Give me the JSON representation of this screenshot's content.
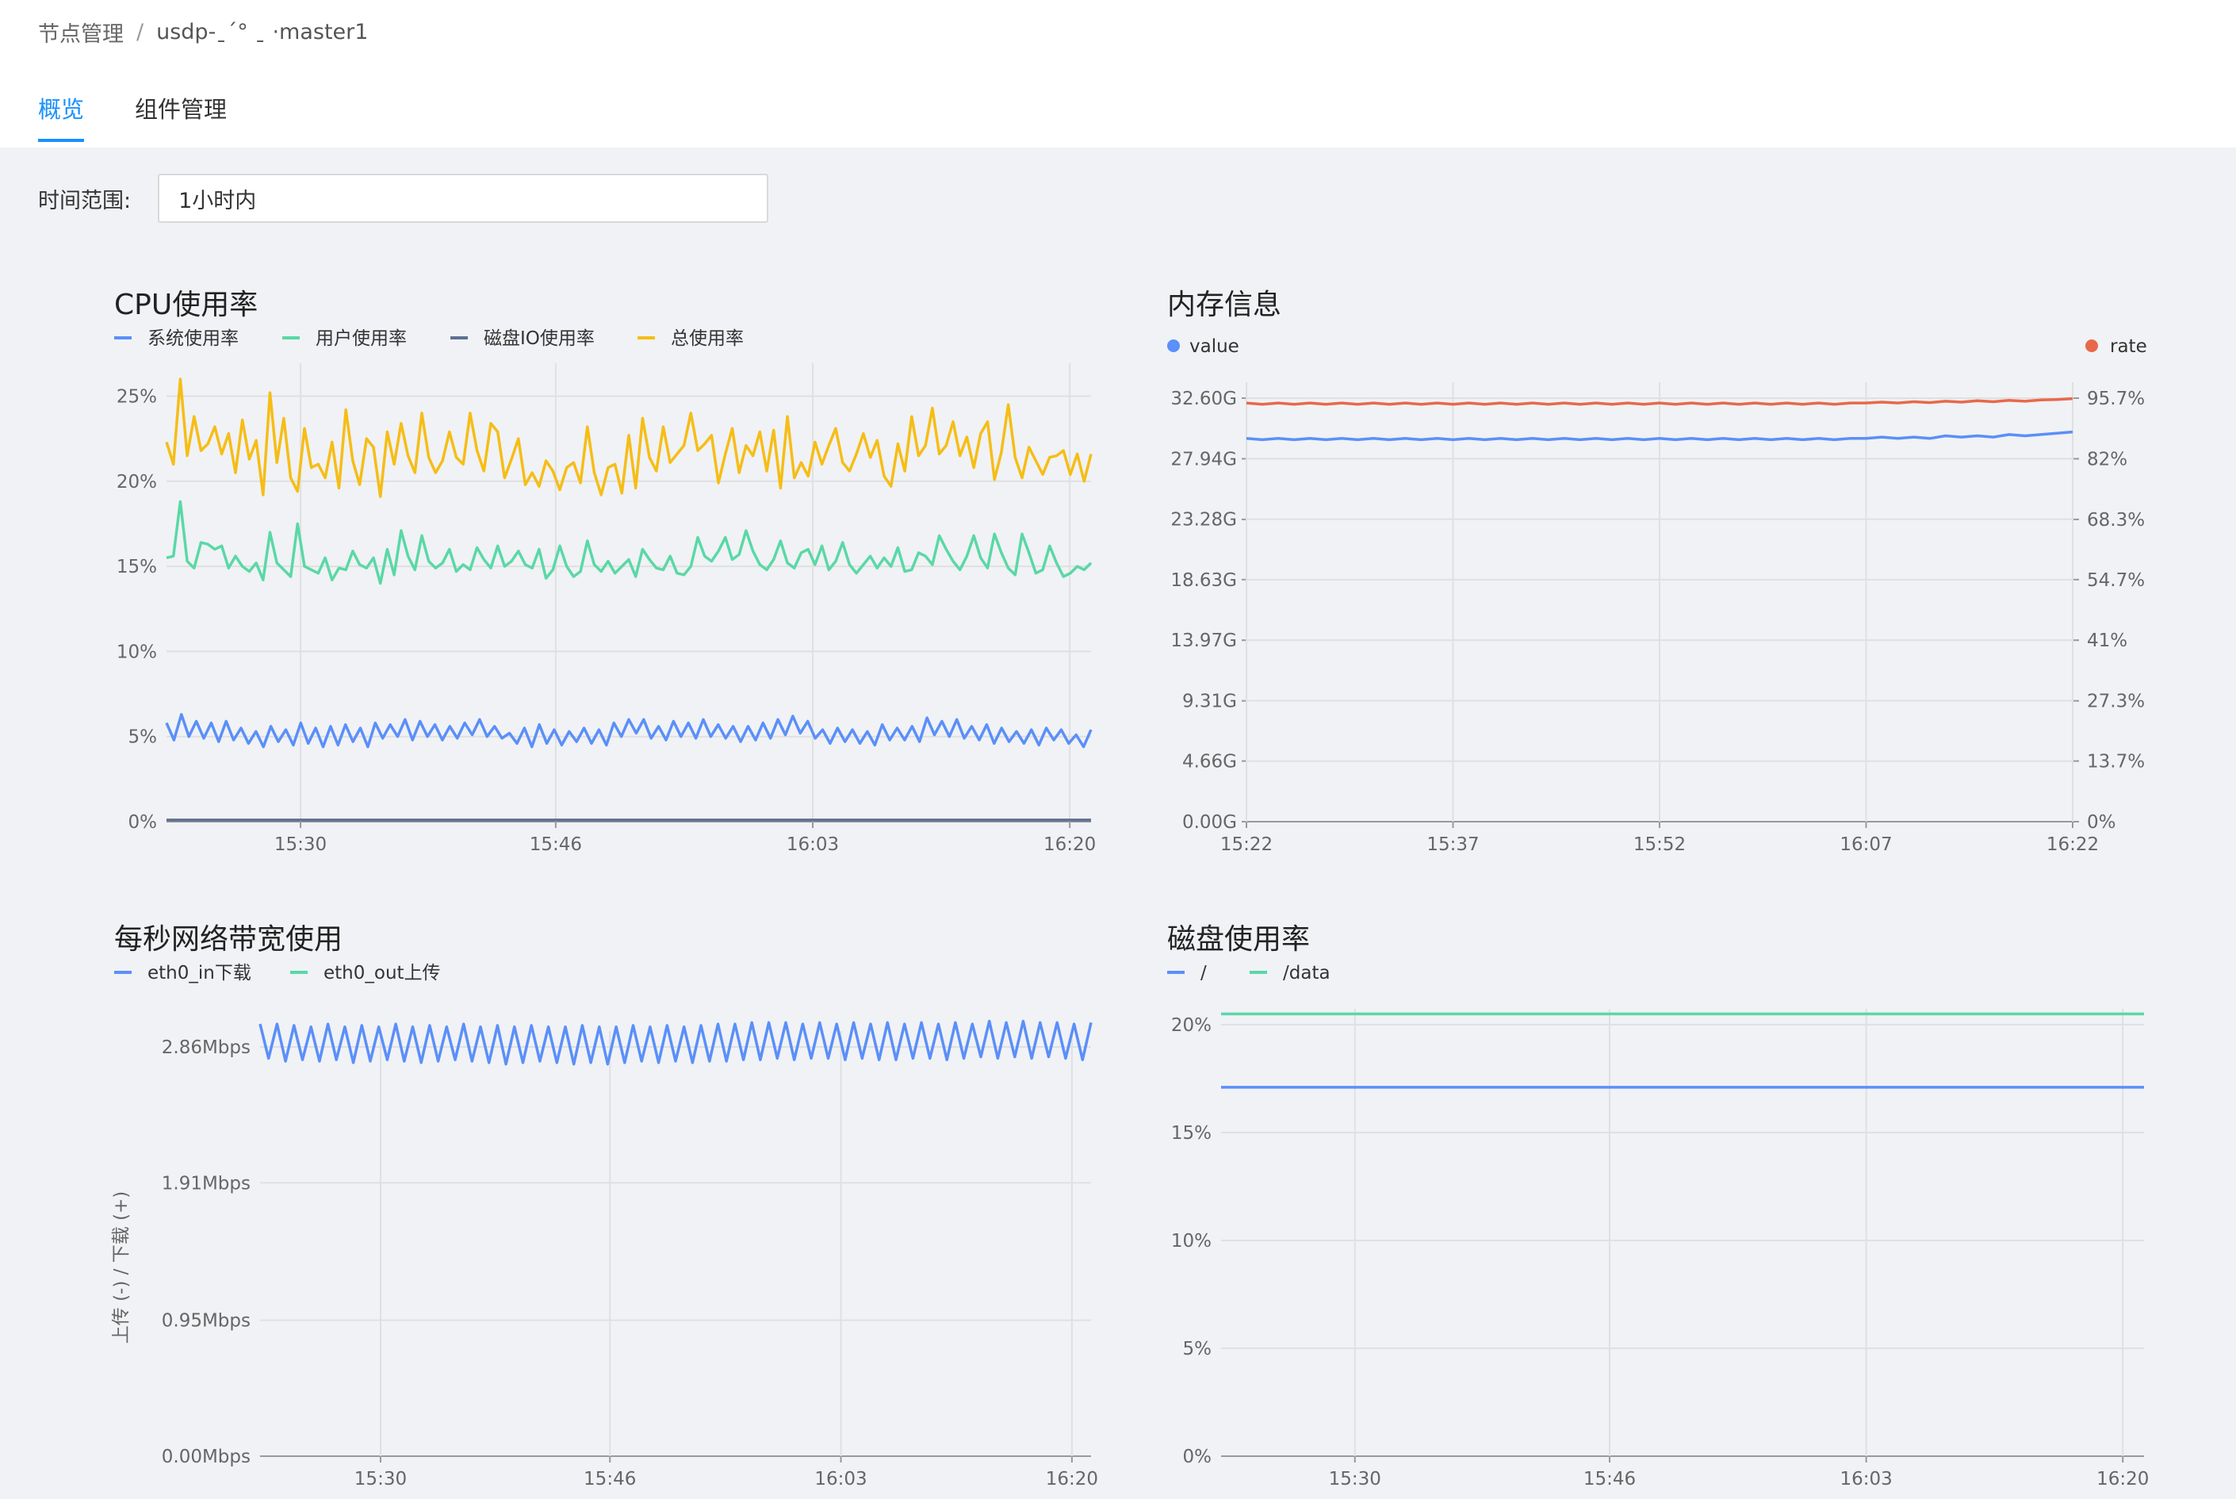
{
  "breadcrumb": {
    "parent": "节点管理",
    "separator": "/",
    "current": "usdp-ˍ´°         ˍ     ·master1"
  },
  "tabs": [
    {
      "label": "概览",
      "active": true
    },
    {
      "label": "组件管理",
      "active": false
    }
  ],
  "time_range": {
    "label": "时间范围:",
    "value": "1小时内"
  },
  "colors": {
    "accent": "#1890ff",
    "blue": "#5b8ff9",
    "green": "#5ad8a6",
    "navy": "#5d7092",
    "yellow": "#f6bd16",
    "red": "#e8684a",
    "grid": "#e0e0e0"
  },
  "chart_data": [
    {
      "id": "cpu",
      "type": "line",
      "title": "CPU使用率",
      "ylim": [
        0,
        26
      ],
      "yticks": [
        0,
        5,
        10,
        15,
        20,
        25
      ],
      "ytick_labels": [
        "0%",
        "5%",
        "10%",
        "15%",
        "20%",
        "25%"
      ],
      "xtick_labels": [
        "15:30",
        "15:46",
        "16:03",
        "16:20"
      ],
      "grid": true,
      "legend": "top-left",
      "series": [
        {
          "name": "系统使用率",
          "color": "#5b8ff9",
          "values": [
            5.8,
            4.8,
            6.3,
            5.0,
            5.9,
            4.9,
            5.8,
            4.7,
            5.9,
            4.8,
            5.5,
            4.6,
            5.3,
            4.4,
            5.6,
            4.7,
            5.4,
            4.5,
            5.8,
            4.6,
            5.5,
            4.4,
            5.6,
            4.5,
            5.7,
            4.7,
            5.5,
            4.4,
            5.8,
            4.9,
            5.7,
            5.0,
            6.0,
            4.8,
            5.9,
            5.0,
            5.7,
            4.8,
            5.6,
            4.9,
            5.8,
            5.1,
            6.0,
            5.0,
            5.6,
            4.9,
            5.2,
            4.6,
            5.5,
            4.4,
            5.7,
            4.6,
            5.4,
            4.5,
            5.3,
            4.7,
            5.5,
            4.6,
            5.4,
            4.5,
            5.8,
            5.0,
            6.0,
            5.2,
            6.0,
            4.9,
            5.6,
            4.8,
            5.9,
            5.0,
            5.8,
            4.9,
            6.0,
            5.0,
            5.7,
            4.9,
            5.6,
            4.7,
            5.6,
            4.8,
            5.8,
            4.9,
            6.0,
            5.1,
            6.2,
            5.2,
            5.9,
            4.9,
            5.4,
            4.6,
            5.5,
            4.7,
            5.4,
            4.6,
            5.3,
            4.5,
            5.7,
            4.8,
            5.5,
            4.8,
            5.6,
            4.7,
            6.1,
            5.1,
            5.9,
            5.0,
            6.0,
            4.9,
            5.6,
            4.8,
            5.7,
            4.6,
            5.5,
            4.7,
            5.3,
            4.6,
            5.4,
            4.5,
            5.5,
            4.8,
            5.4,
            4.6,
            5.1,
            4.4,
            5.4
          ]
        },
        {
          "name": "用户使用率",
          "color": "#5ad8a6",
          "values": [
            15.5,
            15.6,
            18.8,
            15.3,
            14.9,
            16.4,
            16.3,
            16.0,
            16.2,
            14.9,
            15.6,
            15.0,
            14.7,
            15.2,
            14.2,
            17.0,
            15.2,
            14.8,
            14.4,
            17.5,
            15.0,
            14.8,
            14.6,
            15.5,
            14.2,
            14.9,
            14.8,
            15.9,
            15.1,
            14.9,
            15.5,
            14.0,
            16.0,
            14.5,
            17.1,
            15.6,
            14.8,
            16.8,
            15.3,
            14.9,
            15.2,
            16.0,
            14.7,
            15.1,
            14.8,
            16.1,
            15.4,
            14.9,
            16.2,
            15.0,
            15.3,
            15.9,
            15.1,
            14.9,
            16.0,
            14.3,
            14.8,
            16.2,
            15.0,
            14.4,
            14.7,
            16.5,
            15.1,
            14.7,
            15.3,
            14.6,
            15.0,
            15.4,
            14.4,
            16.0,
            15.4,
            14.9,
            14.8,
            15.6,
            14.6,
            14.5,
            15.0,
            16.7,
            15.6,
            15.3,
            15.9,
            16.7,
            15.4,
            15.7,
            17.1,
            15.9,
            15.1,
            14.8,
            15.4,
            16.5,
            15.2,
            14.9,
            15.8,
            16.0,
            15.1,
            16.2,
            14.8,
            15.3,
            16.4,
            15.1,
            14.6,
            15.1,
            15.6,
            14.9,
            15.5,
            15.0,
            16.1,
            14.7,
            14.8,
            15.8,
            15.6,
            15.1,
            16.8,
            16.0,
            15.3,
            14.8,
            15.6,
            16.8,
            15.5,
            14.9,
            16.9,
            15.8,
            14.9,
            14.5,
            16.9,
            15.8,
            14.6,
            14.8,
            16.2,
            15.2,
            14.4,
            14.6,
            15.0,
            14.8,
            15.2
          ]
        },
        {
          "name": "磁盘IO使用率",
          "color": "#5d7092",
          "values": [
            0.1,
            0.1,
            0.1,
            0.1,
            0.1,
            0.1,
            0.1,
            0.1,
            0.1,
            0.1,
            0.1,
            0.1,
            0.1,
            0.1,
            0.1,
            0.1,
            0.1,
            0.1,
            0.1,
            0.1,
            0.1,
            0.1,
            0.1,
            0.1,
            0.1,
            0.1,
            0.1,
            0.1,
            0.1,
            0.1,
            0.1,
            0.1,
            0.1,
            0.1,
            0.1,
            0.1,
            0.1,
            0.1,
            0.1,
            0.1
          ]
        },
        {
          "name": "总使用率",
          "color": "#f6bd16",
          "values": [
            22.3,
            21.0,
            26.0,
            21.5,
            23.8,
            21.8,
            22.2,
            23.2,
            21.6,
            22.8,
            20.5,
            23.6,
            21.3,
            22.4,
            19.2,
            25.2,
            21.1,
            23.7,
            20.2,
            19.4,
            23.1,
            20.8,
            21.0,
            20.2,
            22.3,
            19.6,
            24.2,
            21.2,
            19.8,
            22.5,
            22.0,
            19.1,
            22.9,
            21.0,
            23.4,
            21.5,
            20.5,
            24.0,
            21.4,
            20.5,
            21.2,
            22.9,
            21.4,
            21.0,
            24.0,
            21.8,
            20.6,
            23.4,
            22.9,
            20.2,
            21.3,
            22.5,
            19.8,
            20.5,
            19.7,
            21.2,
            20.6,
            19.5,
            20.8,
            21.1,
            19.9,
            23.2,
            20.5,
            19.2,
            20.8,
            21.0,
            19.3,
            22.7,
            19.6,
            23.7,
            21.4,
            20.6,
            23.2,
            21.1,
            21.6,
            22.1,
            24.0,
            21.8,
            22.2,
            22.7,
            19.9,
            21.6,
            23.1,
            20.5,
            22.1,
            21.5,
            22.9,
            20.6,
            23.0,
            19.6,
            23.8,
            20.2,
            21.1,
            20.3,
            22.3,
            21.0,
            22.1,
            23.1,
            21.1,
            20.6,
            21.6,
            22.8,
            21.4,
            22.4,
            20.3,
            19.7,
            22.2,
            20.6,
            23.8,
            21.5,
            22.1,
            24.3,
            21.6,
            22.1,
            23.5,
            21.5,
            22.6,
            20.8,
            22.8,
            23.5,
            20.1,
            21.7,
            24.5,
            21.4,
            20.2,
            22.0,
            21.2,
            20.4,
            21.4,
            21.5,
            21.8,
            20.4,
            21.6,
            20.0,
            21.6
          ]
        }
      ]
    },
    {
      "id": "memory",
      "type": "line",
      "title": "内存信息",
      "ylim": [
        0,
        32.6
      ],
      "yticks": [
        0,
        4.66,
        9.31,
        13.97,
        18.63,
        23.28,
        27.94,
        32.6
      ],
      "ytick_labels": [
        "0.00G",
        "4.66G",
        "9.31G",
        "13.97G",
        "18.63G",
        "23.28G",
        "27.94G",
        "32.60G"
      ],
      "y2lim": [
        0,
        95.7
      ],
      "y2ticks": [
        0,
        13.7,
        27.3,
        41,
        54.7,
        68.3,
        82,
        95.7
      ],
      "y2tick_labels": [
        "0%",
        "13.7%",
        "27.3%",
        "41%",
        "54.7%",
        "68.3%",
        "82%",
        "95.7%"
      ],
      "xtick_labels": [
        "15:22",
        "15:37",
        "15:52",
        "16:07",
        "16:22"
      ],
      "grid": true,
      "legend": "top",
      "series": [
        {
          "name": "value",
          "color": "#5b8ff9",
          "axis": "left",
          "values": [
            29.5,
            29.4,
            29.5,
            29.4,
            29.5,
            29.4,
            29.5,
            29.4,
            29.5,
            29.4,
            29.5,
            29.4,
            29.5,
            29.4,
            29.5,
            29.4,
            29.5,
            29.4,
            29.5,
            29.4,
            29.5,
            29.4,
            29.5,
            29.4,
            29.5,
            29.4,
            29.5,
            29.4,
            29.5,
            29.4,
            29.5,
            29.4,
            29.5,
            29.4,
            29.5,
            29.4,
            29.5,
            29.4,
            29.5,
            29.5,
            29.6,
            29.5,
            29.6,
            29.5,
            29.7,
            29.6,
            29.7,
            29.6,
            29.8,
            29.7,
            29.8,
            29.9,
            30.0
          ]
        },
        {
          "name": "rate",
          "color": "#e8684a",
          "axis": "right",
          "values": [
            94.6,
            94.3,
            94.6,
            94.3,
            94.6,
            94.3,
            94.6,
            94.3,
            94.6,
            94.3,
            94.6,
            94.3,
            94.6,
            94.3,
            94.6,
            94.3,
            94.6,
            94.3,
            94.6,
            94.3,
            94.6,
            94.3,
            94.6,
            94.3,
            94.6,
            94.3,
            94.6,
            94.3,
            94.6,
            94.3,
            94.6,
            94.3,
            94.6,
            94.3,
            94.6,
            94.3,
            94.6,
            94.3,
            94.6,
            94.6,
            94.8,
            94.6,
            94.9,
            94.7,
            95.0,
            94.8,
            95.1,
            94.9,
            95.2,
            95.0,
            95.3,
            95.4,
            95.6
          ]
        }
      ]
    },
    {
      "id": "network",
      "type": "line",
      "title": "每秒网络带宽使用",
      "ylabel": "上传 (-) / 下载 (+)",
      "ylim": [
        0,
        2.86
      ],
      "yticks": [
        0,
        0.95,
        1.91,
        2.86
      ],
      "ytick_labels": [
        "0.00Mbps",
        "0.95Mbps",
        "1.91Mbps",
        "2.86Mbps"
      ],
      "xtick_labels": [
        "15:30",
        "15:46",
        "16:03",
        "16:20"
      ],
      "grid": true,
      "legend": "top-left",
      "series": [
        {
          "name": "eth0_in下载",
          "color": "#5b8ff9",
          "values": [
            3.02,
            2.78,
            3.02,
            2.76,
            3.01,
            2.77,
            3.0,
            2.76,
            3.02,
            2.77,
            3.0,
            2.75,
            3.01,
            2.76,
            3.0,
            2.77,
            3.02,
            2.76,
            3.0,
            2.75,
            3.01,
            2.76,
            3.0,
            2.77,
            3.02,
            2.76,
            3.0,
            2.75,
            3.01,
            2.74,
            3.0,
            2.75,
            3.01,
            2.76,
            3.0,
            2.75,
            3.0,
            2.74,
            3.01,
            2.75,
            3.0,
            2.74,
            3.0,
            2.75,
            3.01,
            2.76,
            3.0,
            2.75,
            3.01,
            2.76,
            3.0,
            2.75,
            3.01,
            2.76,
            3.02,
            2.76,
            3.02,
            2.77,
            3.03,
            2.77,
            3.03,
            2.78,
            3.03,
            2.77,
            3.02,
            2.78,
            3.03,
            2.78,
            3.02,
            2.77,
            3.03,
            2.78,
            3.02,
            2.77,
            3.03,
            2.77,
            3.02,
            2.78,
            3.03,
            2.78,
            3.02,
            2.77,
            3.03,
            2.78,
            3.02,
            2.79,
            3.04,
            2.78,
            3.03,
            2.79,
            3.04,
            2.78,
            3.03,
            2.79,
            3.03,
            2.78,
            3.02,
            2.77,
            3.03
          ]
        },
        {
          "name": "eth0_out上传",
          "color": "#5ad8a6",
          "values": []
        }
      ]
    },
    {
      "id": "disk",
      "type": "line",
      "title": "磁盘使用率",
      "ylim": [
        0,
        20
      ],
      "yticks": [
        0,
        5,
        10,
        15,
        20
      ],
      "ytick_labels": [
        "0%",
        "5%",
        "10%",
        "15%",
        "20%"
      ],
      "xtick_labels": [
        "15:30",
        "15:46",
        "16:03",
        "16:20"
      ],
      "grid": true,
      "legend": "top-left",
      "series": [
        {
          "name": "/",
          "color": "#5b8ff9",
          "values": [
            17.1,
            17.1,
            17.1,
            17.1,
            17.1,
            17.1,
            17.1,
            17.1,
            17.1,
            17.1
          ]
        },
        {
          "name": "/data",
          "color": "#5ad8a6",
          "values": [
            20.5,
            20.5,
            20.5,
            20.5,
            20.5,
            20.5,
            20.5,
            20.5,
            20.5,
            20.5
          ]
        }
      ]
    }
  ]
}
